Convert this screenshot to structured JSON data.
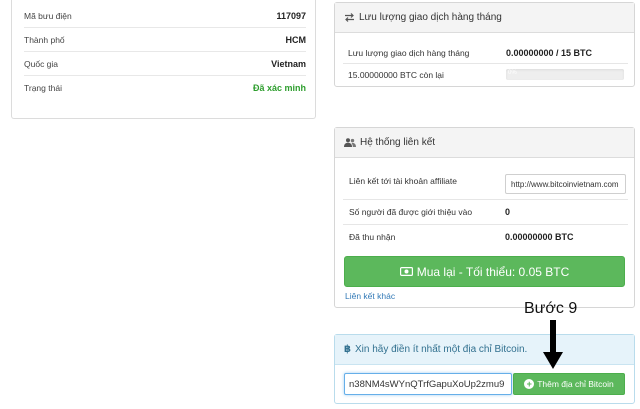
{
  "profile": {
    "rows": [
      {
        "label": "Mã bưu điện",
        "value": "117097"
      },
      {
        "label": "Thành phố",
        "value": "HCM"
      },
      {
        "label": "Quốc gia",
        "value": "Vietnam"
      },
      {
        "label": "Trạng thái",
        "value": "Đã xác minh"
      }
    ]
  },
  "traffic": {
    "title": "Lưu lượng giao dịch hàng tháng",
    "row_label": "Lưu lượng giao dịch hàng tháng",
    "row_value": "0.00000000 / 15 BTC",
    "remaining": "15.00000000 BTC còn lại",
    "progress_text": "0%",
    "progress_fraction": 0.0
  },
  "affiliate": {
    "title": "Hệ thống liên kết",
    "link_label": "Liên kết tới tài khoản affiliate",
    "link_value": "http://www.bitcoinvietnam.com",
    "referred_label": "Số người đã được giới thiệu vào",
    "referred_value": "0",
    "earned_label": "Đã thu nhận",
    "earned_value": "0.00000000 BTC",
    "buy_button": "Mua lại - Tối thiểu: 0.05 BTC",
    "other_link": "Liên kết khác"
  },
  "bitcoin": {
    "title": "Xin hãy điền ít nhất một địa chỉ Bitcoin.",
    "address_value": "n38NM4sWYnQTrfGapuXoUp2zmu9",
    "add_button": "Thêm địa chỉ Bitcoin"
  },
  "annotation": {
    "step_label": "Bước 9"
  },
  "colors": {
    "success": "#5cb85c",
    "verified": "#2e9e2e",
    "info_bg": "#e6f3fa",
    "link": "#337ab7"
  },
  "icons": {
    "traffic": "exchange-icon",
    "affiliate": "users-icon",
    "bitcoin": "bitcoin-icon",
    "buy": "money-icon",
    "add": "plus-circle-icon",
    "annotation": "arrow-down-icon"
  }
}
